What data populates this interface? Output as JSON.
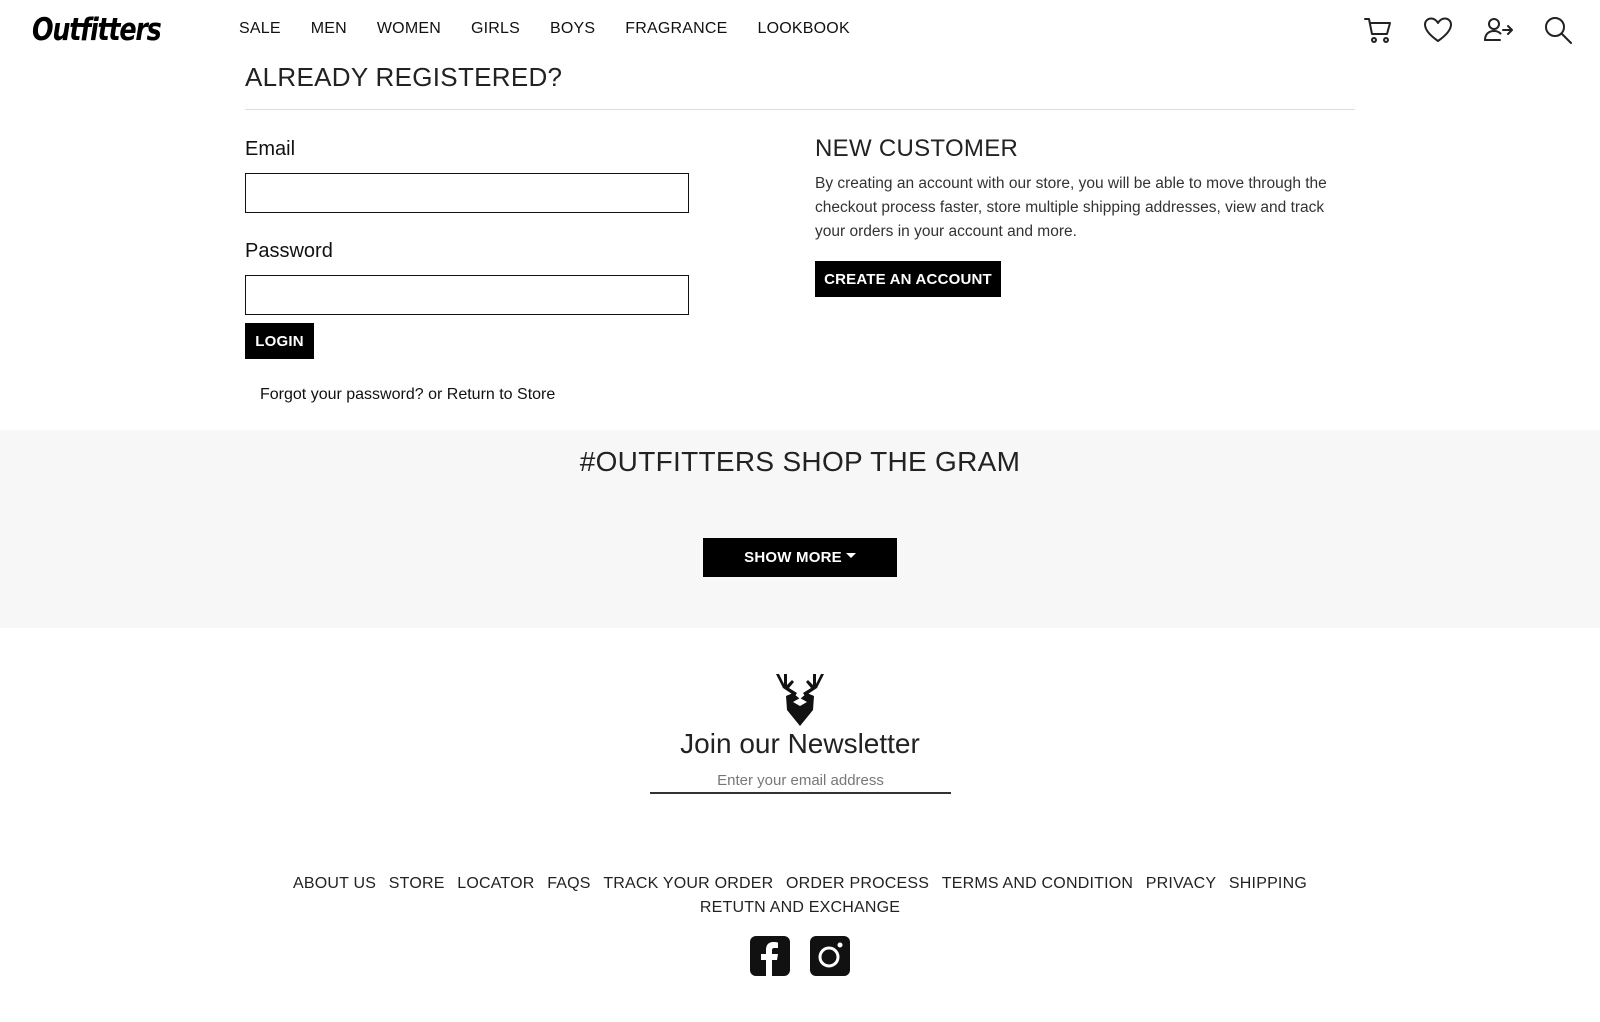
{
  "header": {
    "logo": "Outfitters",
    "nav": [
      "SALE",
      "MEN",
      "WOMEN",
      "GIRLS",
      "BOYS",
      "FRAGRANCE",
      "LOOKBOOK"
    ],
    "icons": [
      "cart-icon",
      "heart-icon",
      "user-login-icon",
      "search-icon"
    ]
  },
  "login": {
    "title": "ALREADY REGISTERED?",
    "email_label": "Email",
    "email_value": "",
    "password_label": "Password",
    "password_value": "",
    "login_button": "LOGIN",
    "forgot_link": "Forgot your password?",
    "or_text": " or ",
    "return_link": "Return to Store"
  },
  "new_customer": {
    "title": "NEW CUSTOMER",
    "description": "By creating an account with our store, you will be able to move through the checkout process faster, store multiple shipping addresses, view and track your orders in your account and more.",
    "create_button": "CREATE AN ACCOUNT"
  },
  "gram": {
    "title": "#OUTFITTERS SHOP THE GRAM",
    "show_more": "SHOW MORE"
  },
  "newsletter": {
    "title": "Join our Newsletter",
    "placeholder": "Enter your email address",
    "icon": "deer-logo-icon"
  },
  "footer": {
    "links": [
      "ABOUT US",
      "STORE",
      "LOCATOR",
      "FAQS",
      "TRACK YOUR ORDER",
      "ORDER PROCESS",
      "TERMS AND CONDITION",
      "PRIVACY",
      "SHIPPING"
    ],
    "links_row2": [
      "RETUTN AND EXCHANGE"
    ],
    "social": [
      "facebook-icon",
      "instagram-icon"
    ]
  }
}
